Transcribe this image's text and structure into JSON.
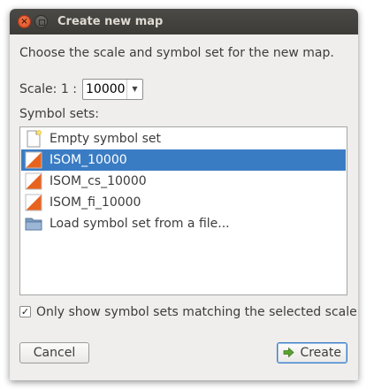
{
  "window": {
    "title": "Create new map"
  },
  "titlebar": {
    "close_glyph": "×",
    "buttons": [
      "close-icon",
      "maximize-icon"
    ]
  },
  "instruction": "Choose the scale and symbol set for the new map.",
  "scale": {
    "label": "Scale:  1 :",
    "value": "10000",
    "dropdown_icon": "chevron-down-icon"
  },
  "symbol_sets": {
    "label": "Symbol sets:",
    "items": [
      {
        "label": "Empty symbol set",
        "icon": "new-document-icon",
        "selected": false
      },
      {
        "label": "ISOM_10000",
        "icon": "orienteering-flag-icon",
        "selected": true
      },
      {
        "label": "ISOM_cs_10000",
        "icon": "orienteering-flag-icon",
        "selected": false
      },
      {
        "label": "ISOM_fi_10000",
        "icon": "orienteering-flag-icon",
        "selected": false
      },
      {
        "label": "Load symbol set from a file...",
        "icon": "folder-icon",
        "selected": false
      }
    ]
  },
  "filter_checkbox": {
    "label": "Only show symbol sets matching the selected scale",
    "checked": true,
    "check_glyph": "✓"
  },
  "buttons": {
    "cancel_label": "Cancel",
    "create_label": "Create"
  },
  "colors": {
    "selection": "#3a7cc4",
    "flag_orange": "#e8631e",
    "titlebar": "#3c3b37"
  }
}
